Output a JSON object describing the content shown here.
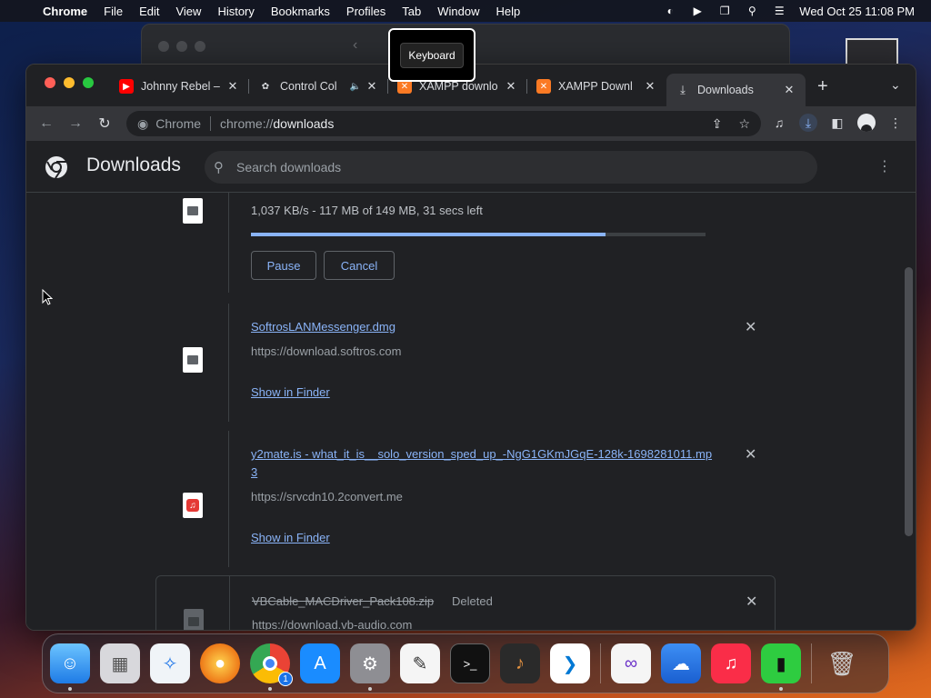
{
  "menubar": {
    "app_name": "Chrome",
    "items": [
      "File",
      "Edit",
      "View",
      "History",
      "Bookmarks",
      "Profiles",
      "Tab",
      "Window",
      "Help"
    ],
    "datetime": "Wed Oct 25  11:08 PM"
  },
  "tooltip": {
    "label": "Keyboard"
  },
  "tabs": [
    {
      "title": "Johnny Rebel –",
      "favicon": "youtube-icon",
      "color": "#ff0000"
    },
    {
      "title": "Control Col",
      "favicon": "control-icon",
      "color": "#9aa0a6",
      "audio": true
    },
    {
      "title": "XAMPP downlo",
      "favicon": "xampp-icon",
      "color": "#fb7a24"
    },
    {
      "title": "XAMPP Downl",
      "favicon": "xampp-icon",
      "color": "#fb7a24"
    },
    {
      "title": "Downloads",
      "favicon": "download-icon",
      "color": "#dadce0",
      "active": true
    }
  ],
  "omnibox": {
    "site_label": "Chrome",
    "url_scheme": "chrome://",
    "url_path": "downloads"
  },
  "downloads_page": {
    "title": "Downloads",
    "search_placeholder": "Search downloads"
  },
  "downloads": {
    "in_progress": {
      "status": "1,037 KB/s - 117 MB of 149 MB, 31 secs left",
      "progress": 0.78,
      "pause_label": "Pause",
      "cancel_label": "Cancel"
    },
    "item1": {
      "filename": "SoftrosLANMessenger.dmg",
      "url": "https://download.softros.com",
      "action": "Show in Finder"
    },
    "item2": {
      "filename": "y2mate.is - what_it_is__solo_version_sped_up_-NgG1GKmJGqE-128k-1698281011.mp3",
      "url": "https://srvcdn10.2convert.me",
      "action": "Show in Finder"
    },
    "item3": {
      "filename": "VBCable_MACDriver_Pack108.zip",
      "status": "Deleted",
      "url": "https://download.vb-audio.com"
    }
  },
  "colors": {
    "accent": "#8ab4f8",
    "background": "#202124",
    "toolbar": "#35363a"
  },
  "dock": {
    "apps": [
      "Finder",
      "Launchpad",
      "Safari",
      "Firefox",
      "Chrome",
      "App Store",
      "System Settings",
      "TextEdit",
      "Terminal",
      "GarageBand",
      "VS Code",
      "Visual Studio",
      "Weather",
      "Music",
      "Zipper",
      "Trash"
    ],
    "chrome_badge": "1"
  }
}
